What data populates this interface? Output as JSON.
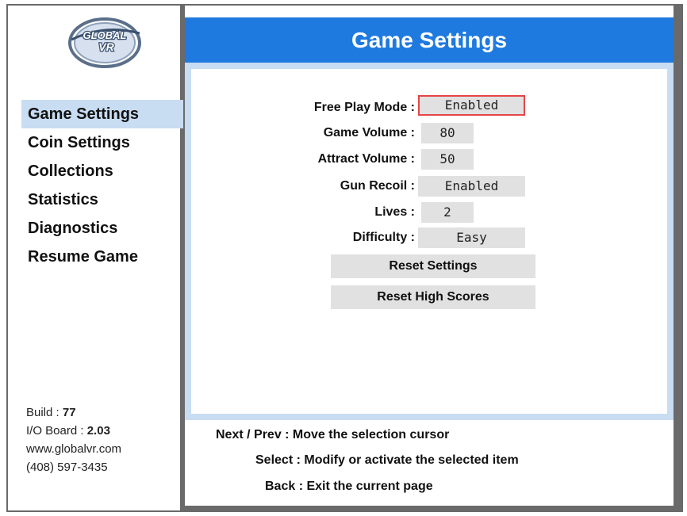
{
  "logo": {
    "text": "GLOBAL VR",
    "icon": "globalvr-logo"
  },
  "menu": {
    "items": [
      {
        "label": "Game Settings",
        "active": true
      },
      {
        "label": "Coin Settings",
        "active": false
      },
      {
        "label": "Collections",
        "active": false
      },
      {
        "label": "Statistics",
        "active": false
      },
      {
        "label": "Diagnostics",
        "active": false
      },
      {
        "label": "Resume Game",
        "active": false
      }
    ]
  },
  "info": {
    "build_label": "Build :",
    "build_value": "77",
    "io_label": "I/O Board :",
    "io_value": "2.03",
    "website": "www.globalvr.com",
    "phone": "(408) 597-3435"
  },
  "header": {
    "title": "Game Settings"
  },
  "settings": [
    {
      "label": "Free Play Mode :",
      "value": "Enabled",
      "selected": true
    },
    {
      "label": "Game Volume :",
      "value": "80",
      "selected": false
    },
    {
      "label": "Attract Volume :",
      "value": "50",
      "selected": false
    },
    {
      "label": "Gun Recoil :",
      "value": "Enabled",
      "selected": false
    },
    {
      "label": "Lives :",
      "value": "2",
      "selected": false
    },
    {
      "label": "Difficulty :",
      "value": "Easy",
      "selected": false
    }
  ],
  "buttons": {
    "reset_settings": "Reset Settings",
    "reset_high_scores": "Reset High Scores"
  },
  "help": {
    "next_prev": "Next / Prev : Move the selection cursor",
    "select": "Select : Modify or activate the selected item",
    "back": "Back : Exit the current page"
  },
  "colors": {
    "header_bg": "#1f7ae0",
    "highlight": "#c8dcf2",
    "frame": "#6a6a6a",
    "value_bg": "#e1e1e1",
    "selected_border": "#e64545"
  }
}
